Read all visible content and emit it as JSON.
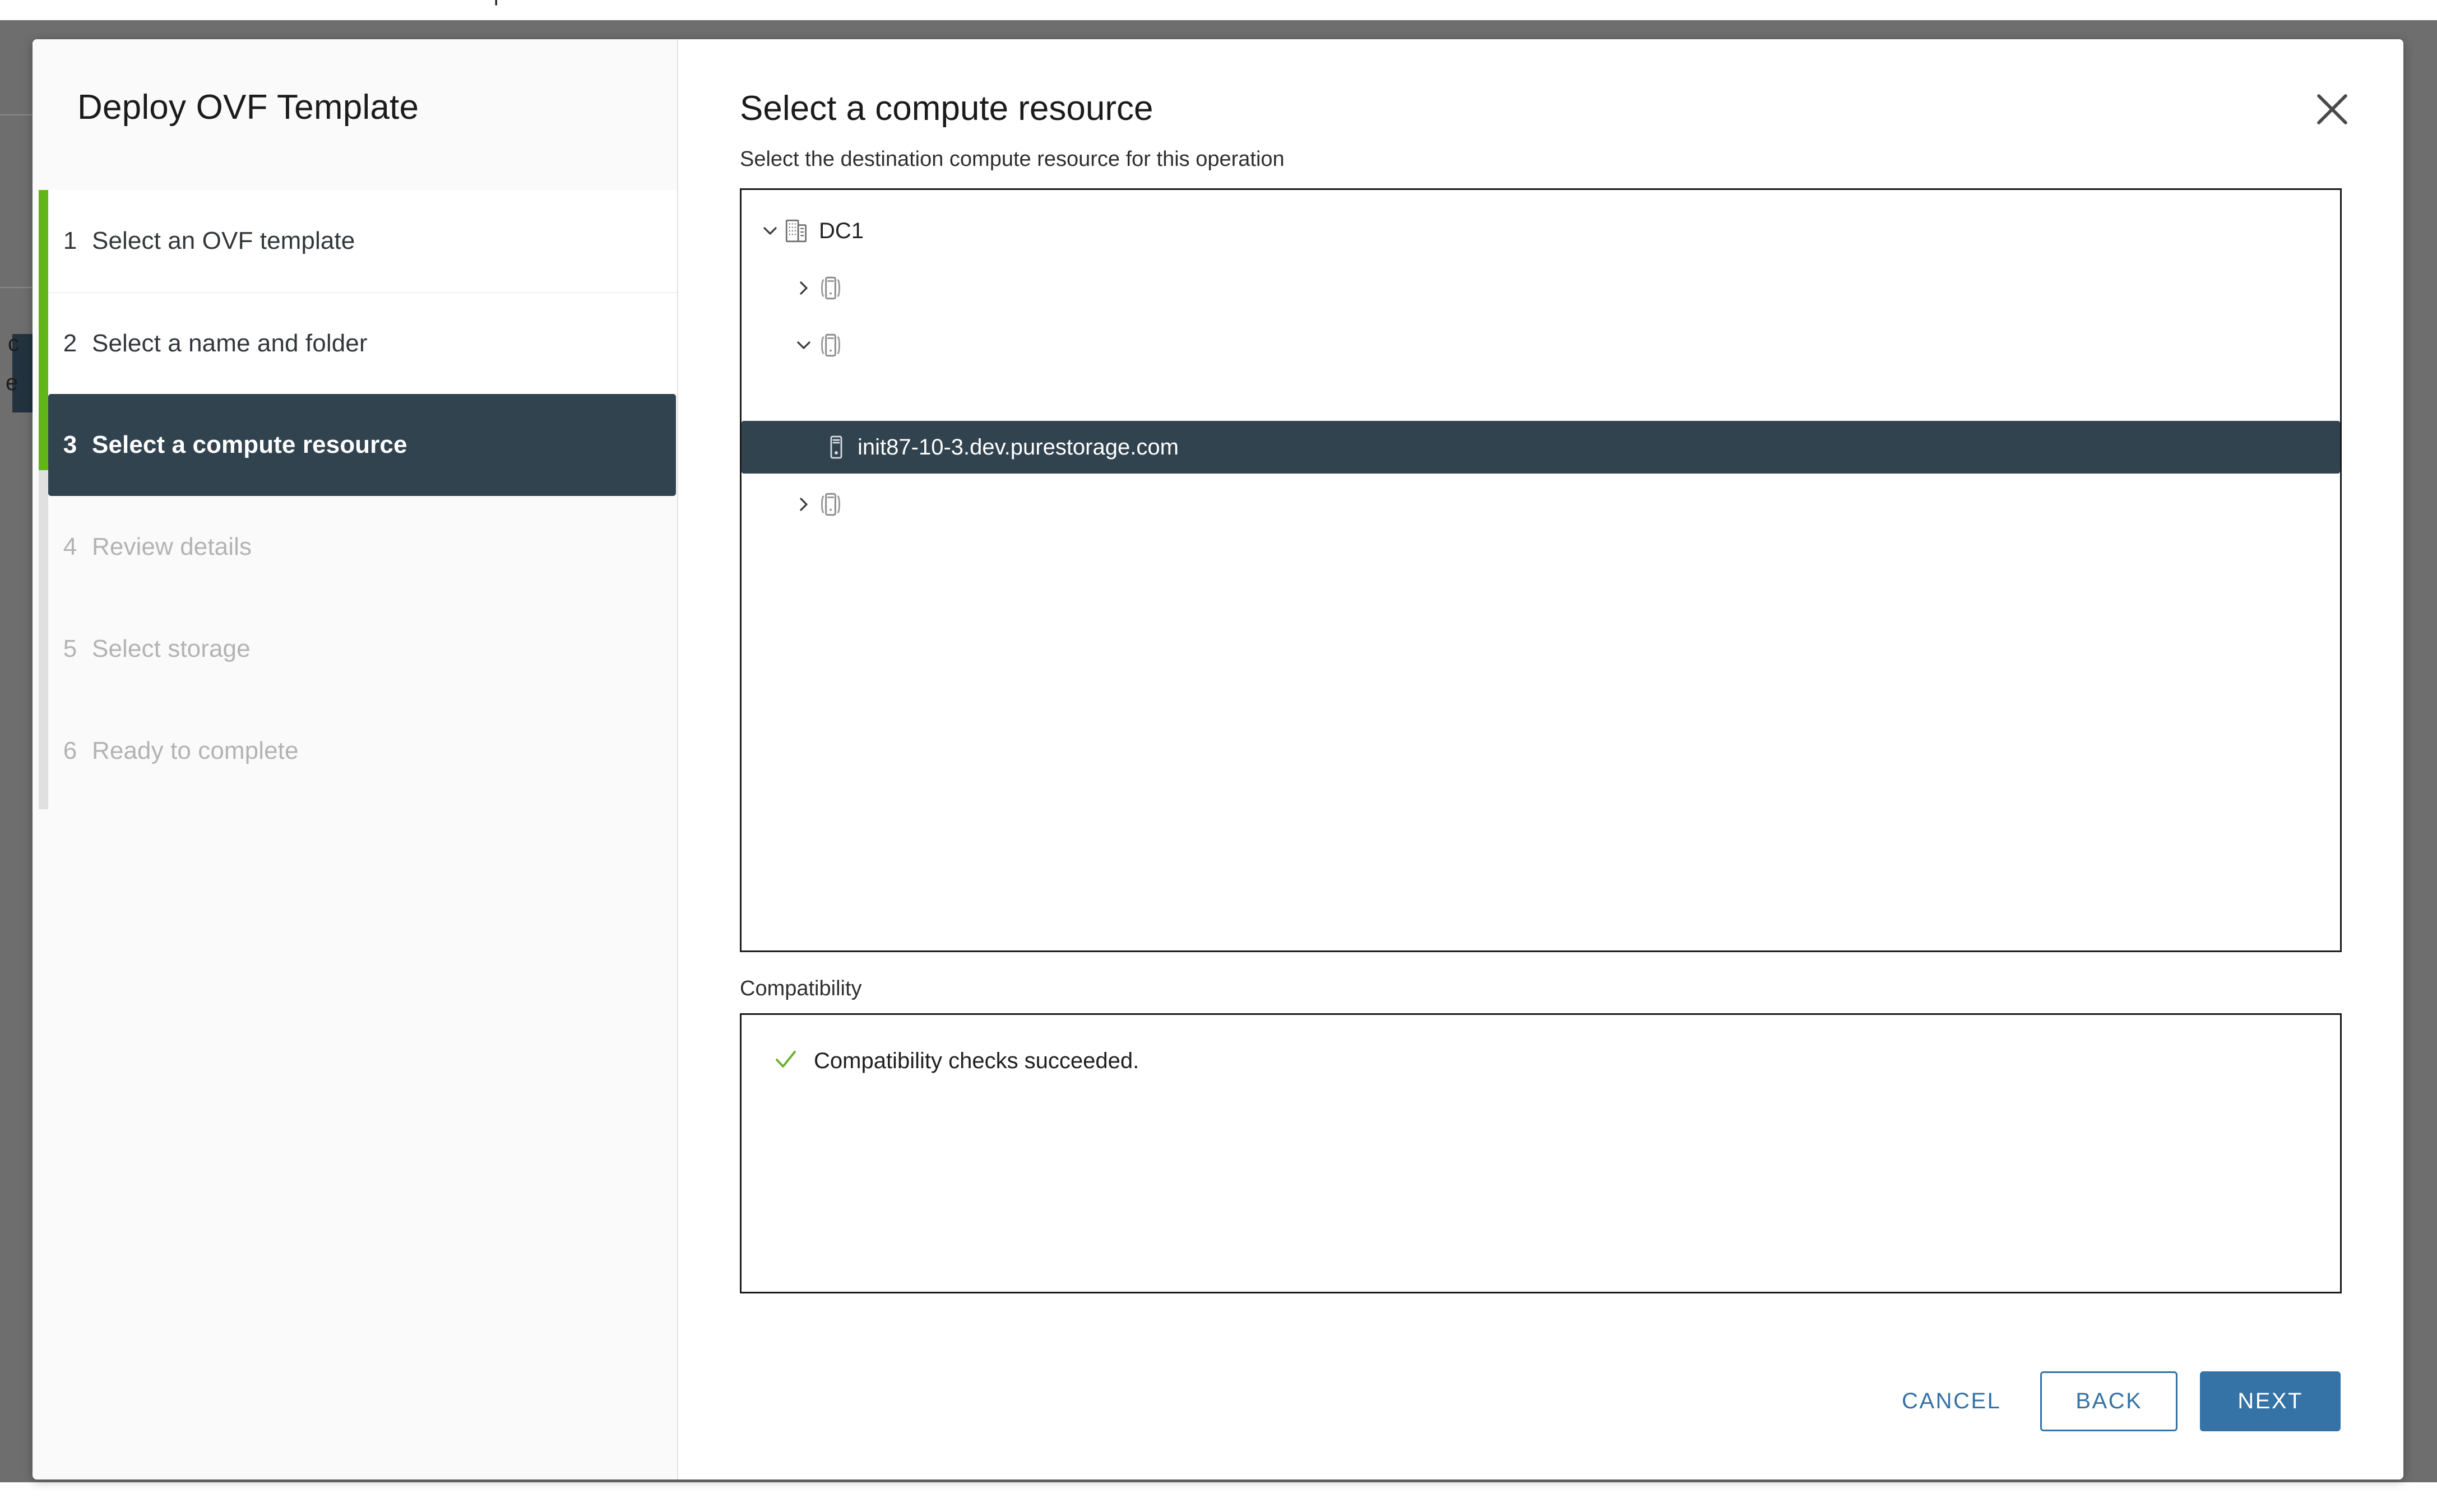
{
  "wizard": {
    "title": "Deploy OVF Template",
    "steps": [
      {
        "num": "1",
        "label": "Select an OVF template",
        "state": "done"
      },
      {
        "num": "2",
        "label": "Select a name and folder",
        "state": "done"
      },
      {
        "num": "3",
        "label": "Select a compute resource",
        "state": "active"
      },
      {
        "num": "4",
        "label": "Review details",
        "state": "pending"
      },
      {
        "num": "5",
        "label": "Select storage",
        "state": "pending"
      },
      {
        "num": "6",
        "label": "Ready to complete",
        "state": "pending"
      }
    ],
    "progress_color": "#62b515",
    "active_color": "#31434f"
  },
  "pane": {
    "title": "Select a compute resource",
    "subtitle": "Select the destination compute resource for this operation",
    "close_icon": "close-icon"
  },
  "tree": {
    "nodes": [
      {
        "label": "DC1",
        "icon": "datacenter-icon",
        "twisty": "chevron-down-icon",
        "indent": 0,
        "selected": false
      },
      {
        "label": "",
        "icon": "cluster-icon",
        "twisty": "chevron-right-icon",
        "indent": 1,
        "selected": false
      },
      {
        "label": "",
        "icon": "cluster-icon",
        "twisty": "chevron-down-icon",
        "indent": 1,
        "selected": false
      },
      {
        "label": "init87-10-3.dev.purestorage.com",
        "icon": "host-icon",
        "twisty": "none",
        "indent": 2,
        "selected": true
      },
      {
        "label": "",
        "icon": "cluster-icon",
        "twisty": "chevron-right-icon",
        "indent": 1,
        "selected": false
      }
    ]
  },
  "compatibility": {
    "label": "Compatibility",
    "status_icon": "check-icon",
    "status_color": "#6aae2e",
    "message": "Compatibility checks succeeded."
  },
  "footer": {
    "cancel_label": "CANCEL",
    "back_label": "BACK",
    "next_label": "NEXT",
    "accent_color": "#3572a5"
  }
}
